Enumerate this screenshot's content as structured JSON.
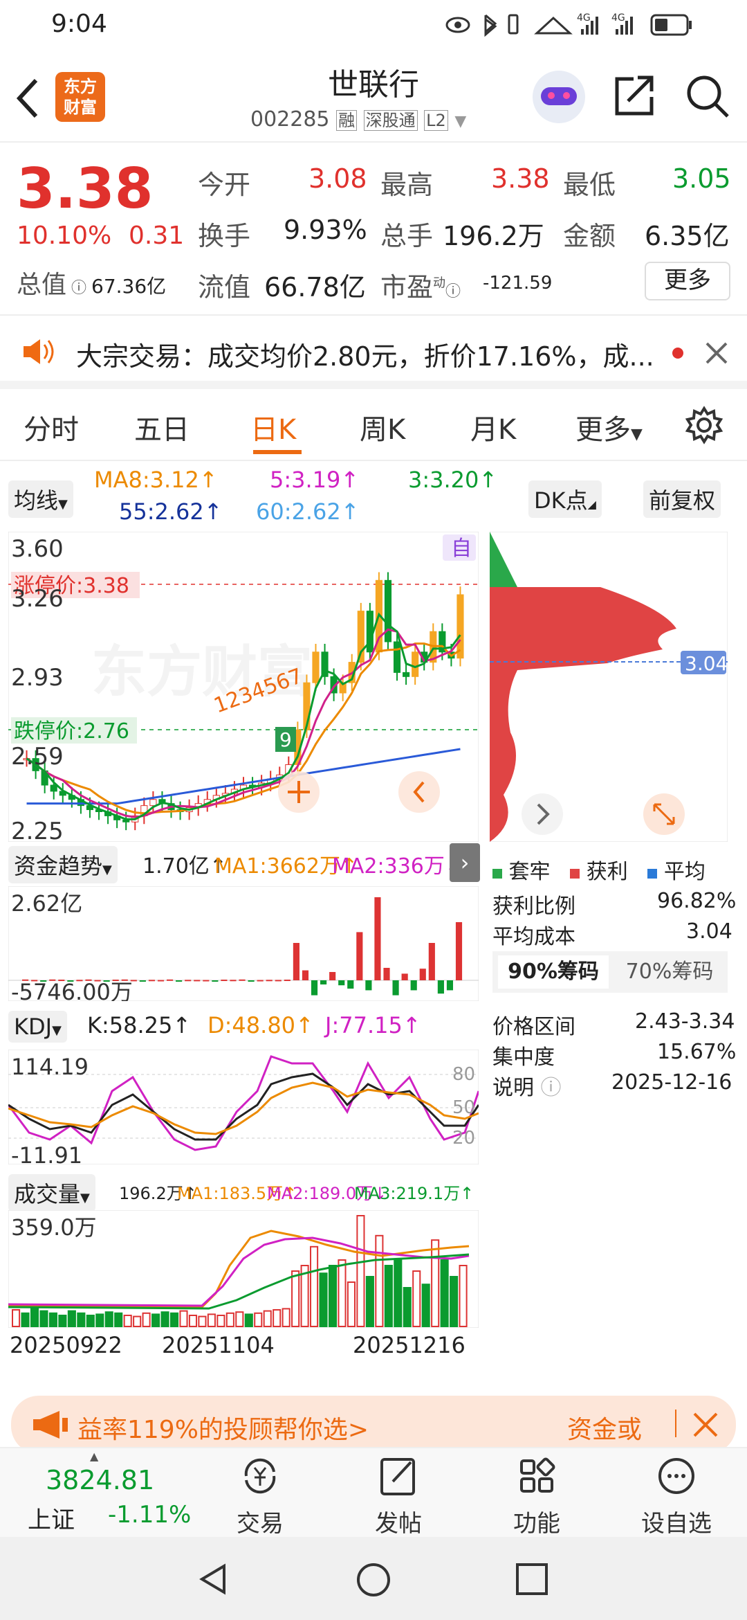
{
  "status": {
    "time": "9:04",
    "net1": "4G",
    "net2": "4G"
  },
  "header": {
    "name": "世联行",
    "code": "002285",
    "tags": [
      "融",
      "深股通",
      "L2"
    ],
    "logo_line1": "东方",
    "logo_line2": "财富"
  },
  "quote": {
    "price": "3.38",
    "pct": "10.10%",
    "chg": "0.31",
    "open_l": "今开",
    "open": "3.08",
    "high_l": "最高",
    "high": "3.38",
    "low_l": "最低",
    "low": "3.05",
    "turn_l": "换手",
    "turn": "9.93%",
    "vol_l": "总手",
    "vol": "196.2万",
    "amt_l": "金额",
    "amt": "6.35亿",
    "mcap_l": "总值",
    "mcap": "67.36亿",
    "flt_l": "流值",
    "flt": "66.78亿",
    "pe_l": "市盈",
    "pe_sup": "动",
    "pe": "-121.59",
    "more": "更多"
  },
  "notice": {
    "text": "大宗交易：成交均价2.80元，折价17.16%，成..."
  },
  "tabs": [
    "分时",
    "五日",
    "日K",
    "周K",
    "月K",
    "更多"
  ],
  "ma": {
    "btn": "均线",
    "ma8": "MA8:3.12↑",
    "ma5": "5:3.19↑",
    "ma3": "3:3.20↑",
    "ma55": "55:2.62↑",
    "ma60": "60:2.62↑",
    "dk": "DK点",
    "fq": "前复权"
  },
  "kline": {
    "y1": "3.60",
    "y2": "3.26",
    "y3": "2.93",
    "y4": "2.59",
    "y5": "2.25",
    "zt": "涨停价:3.38",
    "dt": "跌停价:2.76",
    "self": "自",
    "nine": "9",
    "seq": "1234567",
    "watermark": "东方财富"
  },
  "chip": {
    "price": "3.04",
    "legend": [
      "套牢",
      "获利",
      "平均"
    ],
    "rows": [
      [
        "获利比例",
        "96.82%"
      ],
      [
        "平均成本",
        "3.04"
      ]
    ],
    "tab1": "90%筹码",
    "tab2": "70%筹码",
    "rows2": [
      [
        "价格区间",
        "2.43-3.34"
      ],
      [
        "集中度",
        "15.67%"
      ],
      [
        "说明",
        "2025-12-16"
      ]
    ]
  },
  "fund": {
    "btn": "资金趋势",
    "val": "1.70亿↑",
    "ma1": "MA1:3662万↑",
    "ma2": "MA2:336万↓",
    "top": "2.62亿",
    "bot": "-5746.00万",
    "bars": [
      0.01,
      0.005,
      -0.005,
      0.01,
      0.008,
      -0.004,
      0.006,
      0.01,
      0.004,
      -0.006,
      0.008,
      0.01,
      0.005,
      -0.005,
      0.006,
      0.004,
      0.01,
      -0.008,
      0.006,
      0.005,
      0.004,
      -0.004,
      0.008,
      0.006,
      0.01,
      -0.005,
      0.004,
      0.006,
      0.005,
      0.008,
      0.45,
      0.12,
      -0.18,
      -0.05,
      0.1,
      -0.06,
      -0.1,
      0.58,
      -0.12,
      1.0,
      0.15,
      -0.18,
      0.08,
      -0.12,
      0.14,
      0.45,
      -0.16,
      -0.12,
      0.7
    ]
  },
  "kdj": {
    "btn": "KDJ",
    "k": "K:58.25↑",
    "d": "D:48.80↑",
    "j": "J:77.15↑",
    "top": "114.19",
    "bot": "-11.91",
    "l80": "80",
    "l50": "50",
    "l20": "20"
  },
  "vol": {
    "btn": "成交量",
    "v": "196.2万↑",
    "ma1": "MA1:183.5万↑",
    "ma2": "MA2:189.0万↓",
    "ma3": "MA3:219.1万↑",
    "top": "359.0万",
    "dates": [
      "20250922",
      "20251104",
      "20251216"
    ],
    "bars": [
      0.15,
      0.12,
      0.18,
      0.14,
      0.12,
      0.1,
      0.14,
      0.12,
      0.1,
      0.11,
      0.13,
      0.12,
      0.1,
      0.09,
      0.12,
      0.11,
      0.13,
      0.12,
      0.14,
      0.1,
      0.09,
      0.11,
      0.1,
      0.12,
      0.13,
      0.11,
      0.12,
      0.14,
      0.15,
      0.16,
      0.5,
      0.55,
      0.72,
      0.48,
      0.55,
      0.6,
      0.4,
      1.0,
      0.45,
      0.82,
      0.55,
      0.6,
      0.35,
      0.5,
      0.38,
      0.78,
      0.6,
      0.45,
      0.55
    ]
  },
  "banner": {
    "left": "益率119%的投顾帮你选>",
    "right": "资金或"
  },
  "nav": {
    "index": "3824.81",
    "name": "上证",
    "pct": "-1.11%",
    "items": [
      "交易",
      "发帖",
      "功能",
      "设自选"
    ]
  },
  "chart_data": {
    "type": "candlestick",
    "title": "世联行 日K",
    "price_axis": [
      2.25,
      2.59,
      2.93,
      3.26,
      3.6
    ],
    "closes": [
      2.58,
      2.52,
      2.45,
      2.42,
      2.4,
      2.38,
      2.35,
      2.33,
      2.32,
      2.3,
      2.28,
      2.27,
      2.3,
      2.35,
      2.38,
      2.36,
      2.33,
      2.32,
      2.34,
      2.36,
      2.38,
      2.4,
      2.41,
      2.43,
      2.45,
      2.44,
      2.46,
      2.48,
      2.5,
      2.55,
      2.72,
      2.95,
      3.1,
      2.98,
      2.9,
      2.95,
      3.05,
      3.3,
      3.1,
      3.45,
      3.15,
      3.0,
      2.98,
      3.1,
      3.05,
      3.2,
      3.1,
      3.07,
      3.38
    ]
  }
}
